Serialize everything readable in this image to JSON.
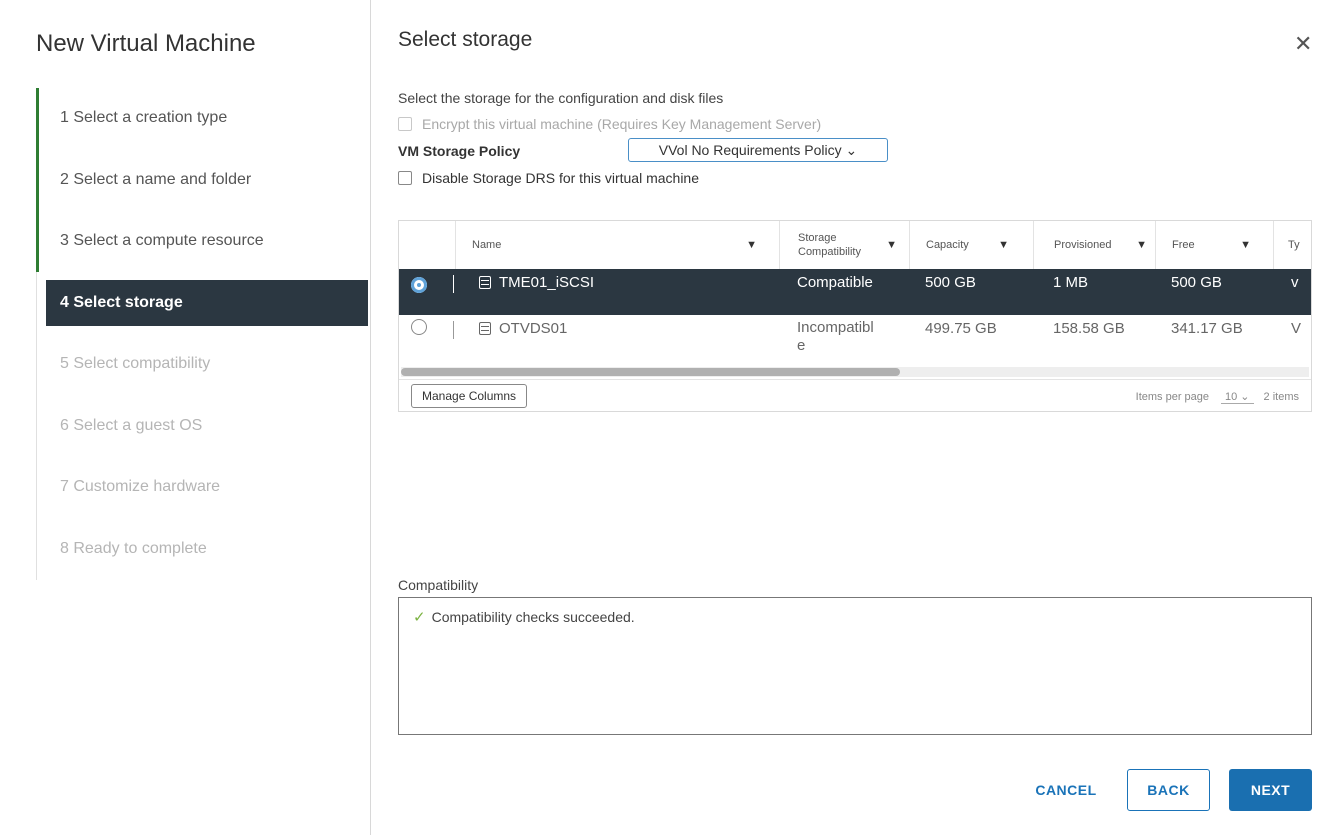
{
  "wizard": {
    "title": "New Virtual Machine",
    "steps": [
      {
        "label": "1  Select a creation type",
        "state": "done"
      },
      {
        "label": "2  Select a name and folder",
        "state": "done"
      },
      {
        "label": "3  Select a compute resource",
        "state": "done"
      },
      {
        "label": "4  Select storage",
        "state": "active"
      },
      {
        "label": "5  Select compatibility",
        "state": "todo"
      },
      {
        "label": "6  Select a guest OS",
        "state": "todo"
      },
      {
        "label": "7  Customize hardware",
        "state": "todo"
      },
      {
        "label": "8  Ready to complete",
        "state": "todo"
      }
    ]
  },
  "panel": {
    "title": "Select storage",
    "close_icon": "close-icon",
    "description": "Select the storage for the configuration and disk files",
    "encrypt_label": "Encrypt this virtual machine (Requires Key Management Server)",
    "encrypt_checked": false,
    "encrypt_disabled": true,
    "policy_label": "VM Storage Policy",
    "policy_value": "VVol No Requirements Policy ⌄",
    "disable_drs_label": "Disable Storage DRS for this virtual machine",
    "disable_drs_checked": false
  },
  "table": {
    "columns": [
      "Name",
      "Storage Compatibility",
      "Capacity",
      "Provisioned",
      "Free",
      "Ty"
    ],
    "rows": [
      {
        "selected": true,
        "name": "TME01_iSCSI",
        "compatibility": "Compatible",
        "capacity": "500 GB",
        "provisioned": "1 MB",
        "free": "500 GB",
        "type": "v"
      },
      {
        "selected": false,
        "name": "OTVDS01",
        "compatibility": "Incompatible",
        "capacity": "499.75 GB",
        "provisioned": "158.58 GB",
        "free": "341.17 GB",
        "type": "V"
      }
    ],
    "manage_columns_label": "Manage Columns",
    "items_per_page_label": "Items per page",
    "items_per_page_value": "10  ⌄",
    "total_items": "2 items",
    "scroll_fraction": 0.55
  },
  "compatibility": {
    "label": "Compatibility",
    "message": "Compatibility checks succeeded.",
    "status_color": "#7cb342"
  },
  "buttons": {
    "cancel": "CANCEL",
    "back": "BACK",
    "next": "NEXT"
  },
  "colors": {
    "accent": "#1a6fb0",
    "active_step_bg": "#2b3741",
    "progress_line": "#2e7d32"
  }
}
